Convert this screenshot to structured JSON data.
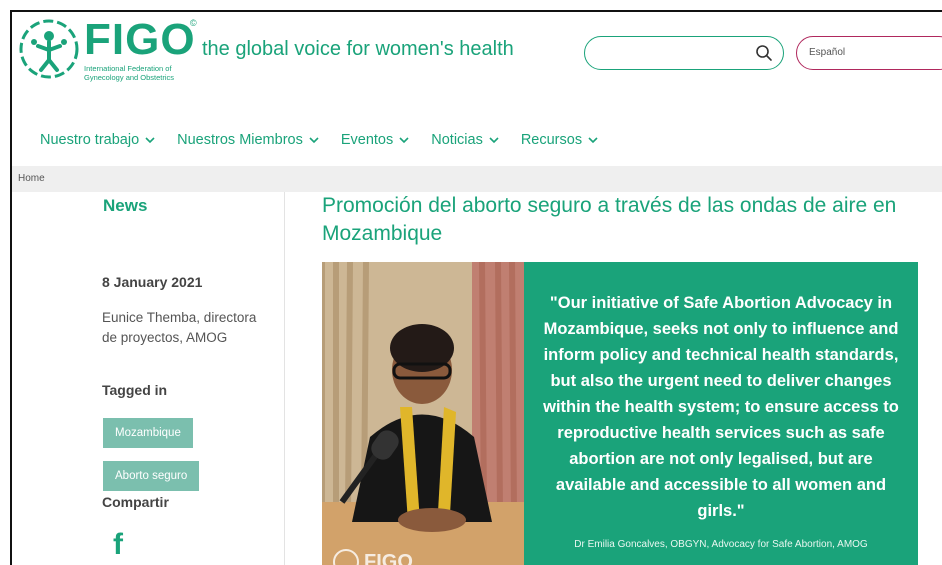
{
  "header": {
    "logo_word": "FIGO",
    "logo_sub_line1": "International Federation of",
    "logo_sub_line2": "Gynecology and Obstetrics",
    "registered": "©",
    "tagline": "the global voice for women's health",
    "search_placeholder": "",
    "language": "Español"
  },
  "nav": {
    "items": [
      {
        "label": "Nuestro trabajo"
      },
      {
        "label": "Nuestros Miembros"
      },
      {
        "label": "Eventos"
      },
      {
        "label": "Noticias"
      },
      {
        "label": "Recursos"
      }
    ]
  },
  "breadcrumb": {
    "home": "Home"
  },
  "sidebar": {
    "section": "News",
    "date": "8 January 2021",
    "author": "Eunice Themba, directora de proyectos, AMOG",
    "tagged_heading": "Tagged in",
    "tags": [
      "Mozambique",
      "Aborto seguro"
    ],
    "share_heading": "Compartir",
    "share_icon": "facebook-icon"
  },
  "article": {
    "title": "Promoción del aborto seguro a través de las ondas de aire en Mozambique",
    "quote": "\"Our initiative of Safe Abortion Advocacy in Mozambique, seeks not only to influence and inform policy and technical health standards, but also the urgent need to deliver changes within the health system; to ensure access to reproductive health services such as safe abortion are not only legalised, but are available and accessible to all women and girls.\"",
    "attribution": "Dr Emilia Goncalves, OBGYN, Advocacy for Safe Abortion, AMOG",
    "photo_watermark": "FIGO"
  },
  "colors": {
    "brand_green": "#1aa37a",
    "tag_bg": "#7bbfae",
    "language_border": "#b0285d"
  }
}
